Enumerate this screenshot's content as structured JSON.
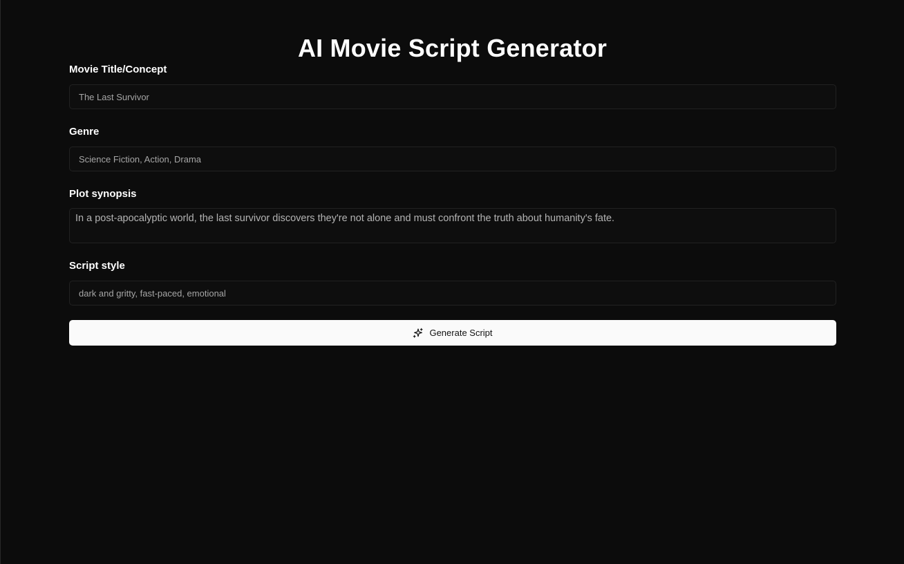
{
  "page": {
    "title": "AI Movie Script Generator"
  },
  "form": {
    "title_field": {
      "label": "Movie Title/Concept",
      "value": "The Last Survivor"
    },
    "genre_field": {
      "label": "Genre",
      "value": "Science Fiction, Action, Drama"
    },
    "synopsis_field": {
      "label": "Plot synopsis",
      "value": "In a post-apocalyptic world, the last survivor discovers they're not alone and must confront the truth about humanity's fate."
    },
    "style_field": {
      "label": "Script style",
      "value": "dark and gritty, fast-paced, emotional"
    },
    "generate_button": {
      "label": "Generate Script",
      "icon": "sparkles-icon"
    }
  },
  "colors": {
    "background": "#0c0c0c",
    "field_border": "#222222",
    "button_bg": "#fafafa",
    "button_text": "#111111"
  }
}
